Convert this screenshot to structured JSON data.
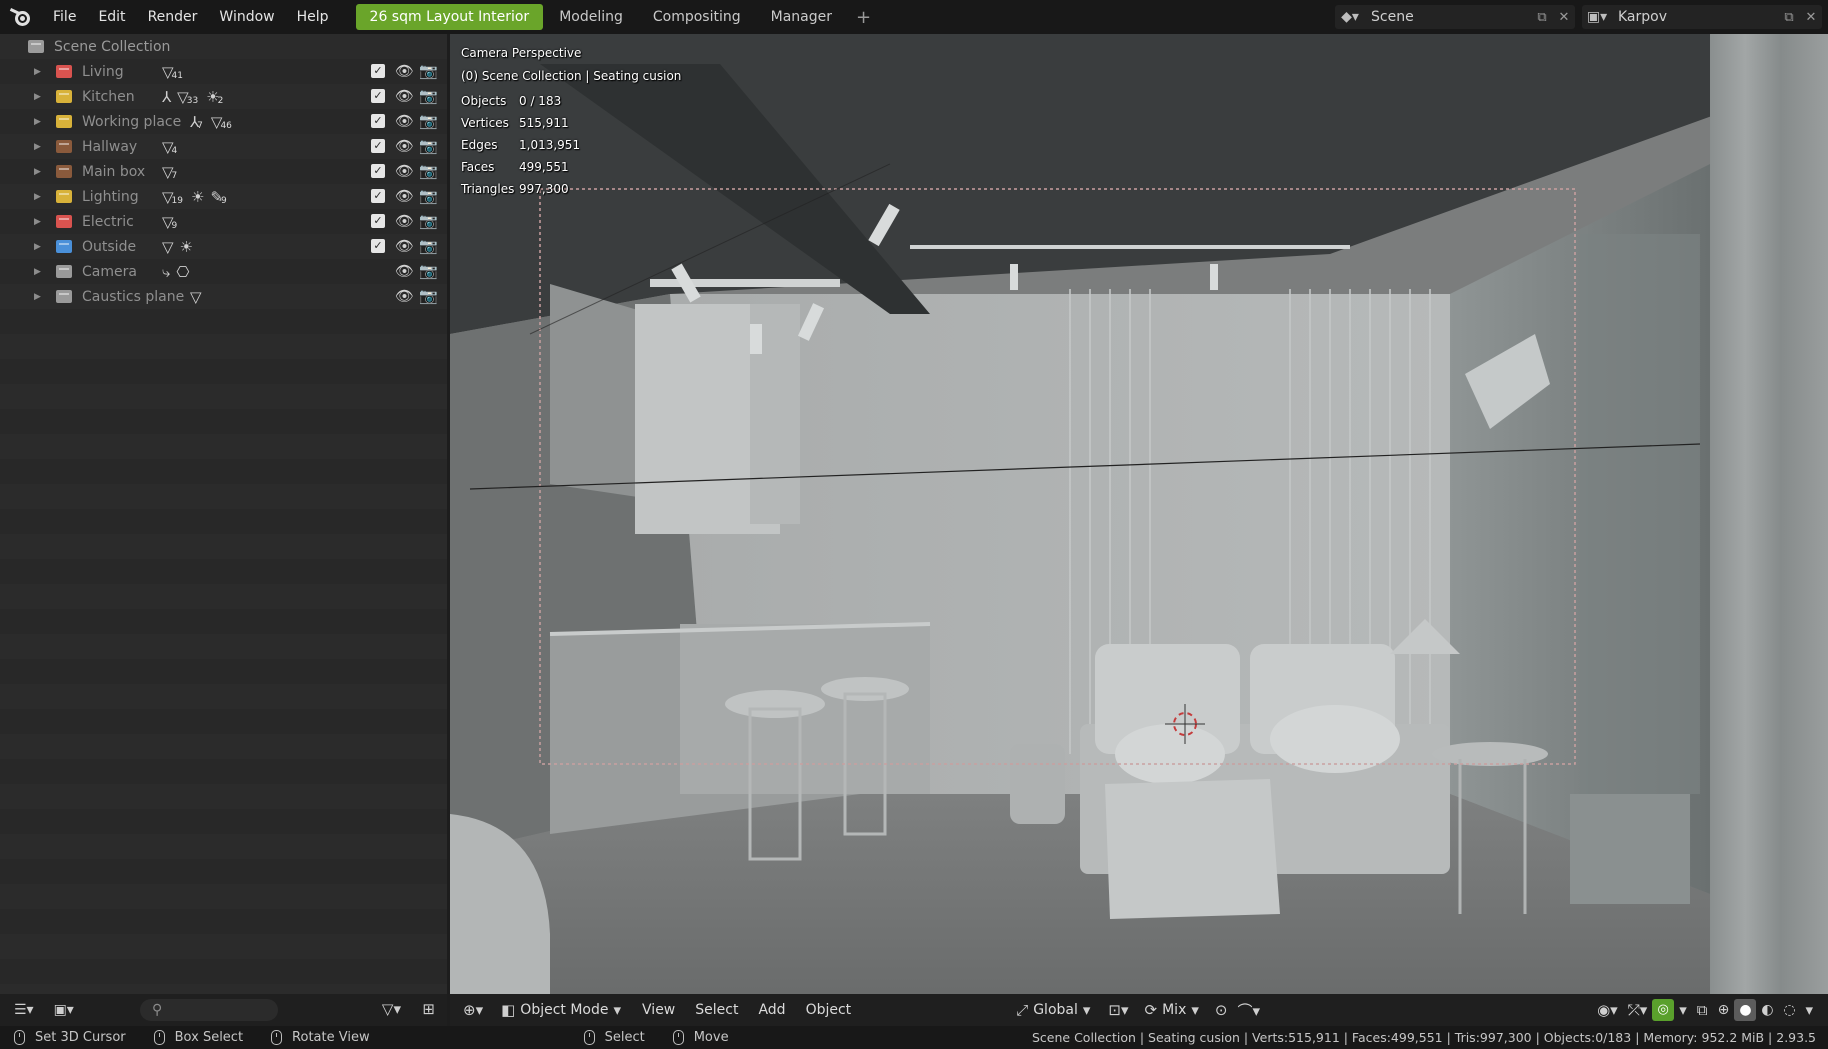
{
  "menubar": {
    "menus": [
      "File",
      "Edit",
      "Render",
      "Window",
      "Help"
    ],
    "workspaces": [
      {
        "label": "26 sqm Layout Interior",
        "active": true
      },
      {
        "label": "Modeling",
        "active": false
      },
      {
        "label": "Compositing",
        "active": false
      },
      {
        "label": "Manager",
        "active": false
      }
    ],
    "add_workspace": "+",
    "scene_name": "Scene",
    "view_layer_name": "Karpov"
  },
  "outliner": {
    "root_label": "Scene Collection",
    "collections": [
      {
        "name": "Living",
        "color": "#d9534f",
        "badges": [
          {
            "sym": "▽",
            "num": "41"
          }
        ],
        "checkbox": true
      },
      {
        "name": "Kitchen",
        "color": "#d8b23a",
        "badges": [
          {
            "sym": "⅄",
            "num": ""
          },
          {
            "sym": "▽",
            "num": "33"
          },
          {
            "sym": "☀",
            "num": "2"
          }
        ],
        "checkbox": true
      },
      {
        "name": "Working place",
        "color": "#d8b23a",
        "badges": [
          {
            "sym": "⅄",
            "num": "7"
          },
          {
            "sym": "▽",
            "num": "46"
          }
        ],
        "checkbox": true
      },
      {
        "name": "Hallway",
        "color": "#8a5a3c",
        "badges": [
          {
            "sym": "▽",
            "num": "4"
          }
        ],
        "checkbox": true
      },
      {
        "name": "Main box",
        "color": "#8a5a3c",
        "badges": [
          {
            "sym": "▽",
            "num": "7"
          }
        ],
        "checkbox": true
      },
      {
        "name": "Lighting",
        "color": "#d8b23a",
        "badges": [
          {
            "sym": "▽",
            "num": "19"
          },
          {
            "sym": "☀",
            "num": ""
          },
          {
            "sym": "✎",
            "num": "9"
          }
        ],
        "checkbox": true
      },
      {
        "name": "Electric",
        "color": "#d9534f",
        "badges": [
          {
            "sym": "▽",
            "num": "9"
          }
        ],
        "checkbox": true
      },
      {
        "name": "Outside",
        "color": "#4a90d9",
        "badges": [
          {
            "sym": "▽",
            "num": ""
          },
          {
            "sym": "☀",
            "num": ""
          }
        ],
        "checkbox": true
      },
      {
        "name": "Camera",
        "color": "#9a9a9a",
        "badges": [
          {
            "sym": "⤷",
            "num": ""
          },
          {
            "sym": "⎔",
            "num": ""
          }
        ],
        "checkbox": false
      },
      {
        "name": "Caustics plane",
        "color": "#9a9a9a",
        "badges": [
          {
            "sym": "▽",
            "num": ""
          }
        ],
        "checkbox": false
      }
    ]
  },
  "viewport": {
    "overlay_title": "Camera Perspective",
    "overlay_collection": "(0) Scene Collection | Seating cusion",
    "stats": [
      {
        "key": "Objects",
        "value": "0 / 183"
      },
      {
        "key": "Vertices",
        "value": "515,911"
      },
      {
        "key": "Edges",
        "value": "1,013,951"
      },
      {
        "key": "Faces",
        "value": "499,551"
      },
      {
        "key": "Triangles",
        "value": "997,300"
      }
    ]
  },
  "viewport_header": {
    "mode": "Object Mode",
    "menus": [
      "View",
      "Select",
      "Add",
      "Object"
    ],
    "orientation": "Global",
    "snap_mode": "Mix"
  },
  "statusbar": {
    "left": [
      {
        "label": "Set 3D Cursor"
      },
      {
        "label": "Box Select"
      },
      {
        "label": "Rotate View"
      },
      {
        "label": "Select"
      },
      {
        "label": "Move"
      }
    ],
    "right": "Scene Collection | Seating cusion | Verts:515,911 | Faces:499,551 | Tris:997,300 | Objects:0/183 | Memory: 952.2 MiB | 2.93.5"
  }
}
